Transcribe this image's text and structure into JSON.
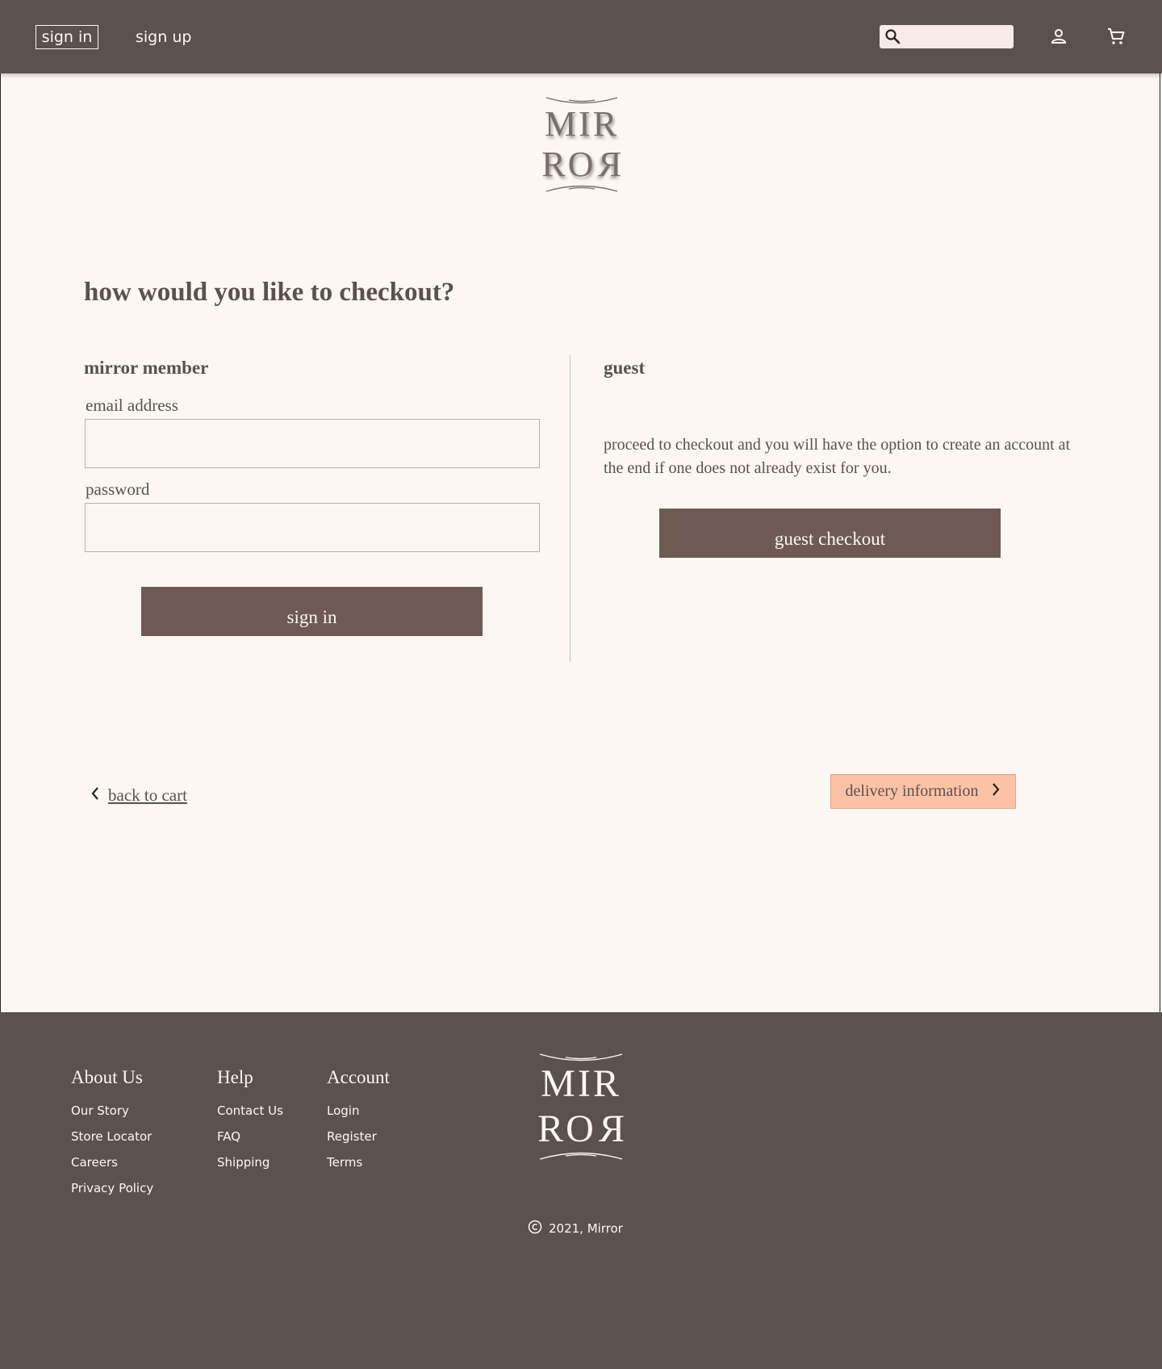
{
  "header": {
    "sign_in": "sign in",
    "sign_up": "sign up",
    "search_placeholder": "",
    "icons": [
      "search-icon",
      "user-icon",
      "cart-icon"
    ]
  },
  "logo": {
    "line1": "MIR",
    "line2": "ROR"
  },
  "page": {
    "title": "how would you like to checkout?"
  },
  "member": {
    "title": "mirror member",
    "email_label": "email address",
    "email_value": "",
    "password_label": "password",
    "password_value": "",
    "sign_in_button": "sign in"
  },
  "guest": {
    "title": "guest",
    "description": "proceed to checkout and you will have the option to create an account at the end if one does not already exist for you.",
    "button": "guest checkout"
  },
  "nav": {
    "back": "back to cart",
    "next": "delivery information"
  },
  "footer": {
    "about": {
      "title": "About Us",
      "items": [
        "Our Story",
        "Store Locator",
        "Careers",
        "Privacy Policy"
      ]
    },
    "help": {
      "title": "Help",
      "items": [
        "Contact Us",
        "FAQ",
        "Shipping"
      ]
    },
    "account": {
      "title": "Account",
      "items": [
        "Login",
        "Register",
        "Terms"
      ]
    },
    "copyright": "2021, Mirror"
  },
  "colors": {
    "header_bg": "#5b514e",
    "page_bg": "#fdf7f3",
    "button_dark": "#6e5953",
    "accent": "#fcc2a6"
  }
}
